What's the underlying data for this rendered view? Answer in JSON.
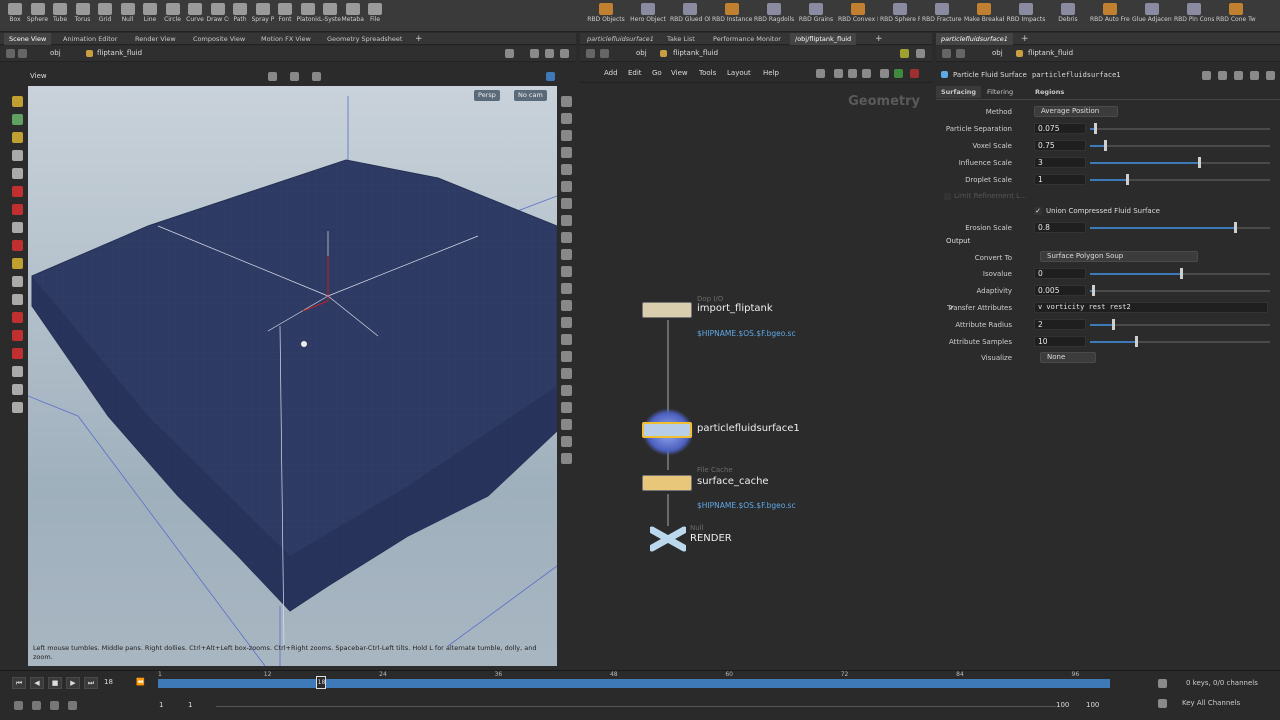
{
  "shelf": {
    "left_tools": [
      "Box",
      "Sphere",
      "Tube",
      "Torus",
      "Grid",
      "Null",
      "Line",
      "Circle",
      "Curve",
      "Draw Curve",
      "Path",
      "Spray Paint",
      "Font",
      "Platonic Solids",
      "L-System",
      "Metaball",
      "File"
    ],
    "right_tools": [
      "RBD Objects",
      "Hero Object",
      "RBD Glued Objects",
      "RBD Instanced Objects",
      "RBD Ragdolls",
      "RBD Grains",
      "RBD Convex Proxy",
      "RBD Sphere Proxy",
      "RBD Fractured Object",
      "Make Breakable",
      "RBD Impacts",
      "Debris",
      "RBD Auto Freeze",
      "Glue Adjacent",
      "RBD Pin Constraint",
      "RBD Cone Twist Const..."
    ]
  },
  "left_pane": {
    "tabs": [
      "Scene View",
      "Animation Editor",
      "Render View",
      "Composite View",
      "Motion FX View",
      "Geometry Spreadsheet"
    ],
    "path_root": "obj",
    "path_node": "fliptank_fluid",
    "view_label": "View",
    "persp_label": "Persp",
    "cam_label": "No cam",
    "help_text": "Left mouse tumbles. Middle pans. Right dollies. Ctrl+Alt+Left box-zooms. Ctrl+Right zooms. Spacebar-Ctrl-Left tilts. Hold L for alternate tumble, dolly, and zoom."
  },
  "mid_pane": {
    "tabs": [
      "particlefluidsurface1",
      "Take List",
      "Performance Monitor",
      "/obj/fliptank_fluid"
    ],
    "path_root": "obj",
    "path_node": "fliptank_fluid",
    "menu": [
      "Add",
      "Edit",
      "Go",
      "View",
      "Tools",
      "Layout",
      "Help"
    ],
    "context_label": "Geometry",
    "nodes": [
      {
        "type": "Dop I/O",
        "name": "import_fliptank",
        "sub": "$HIPNAME.$OS.$F.bgeo.sc",
        "color": "#d9cfae"
      },
      {
        "type": "",
        "name": "particlefluidsurface1",
        "sub": "",
        "color": "#d9cfae"
      },
      {
        "type": "File Cache",
        "name": "surface_cache",
        "sub": "$HIPNAME.$OS.$F.bgeo.sc",
        "color": "#e8c77a"
      },
      {
        "type": "Null",
        "name": "RENDER",
        "sub": "",
        "color": "#bcd8ec"
      }
    ]
  },
  "right_pane": {
    "tab": "particlefluidsurface1",
    "path_root": "obj",
    "path_node": "fliptank_fluid",
    "node_type": "Particle Fluid Surface",
    "node_name": "particlefluidsurface1",
    "param_tabs": [
      "Surfacing",
      "Filtering",
      "Regions"
    ],
    "method_label": "Method",
    "method_value": "Average Position",
    "params": [
      {
        "label": "Particle Separation",
        "value": "0.075",
        "fraction": 0.02
      },
      {
        "label": "Voxel Scale",
        "value": "0.75",
        "fraction": 0.08
      },
      {
        "label": "Influence Scale",
        "value": "3",
        "fraction": 0.6
      },
      {
        "label": "Droplet Scale",
        "value": "1",
        "fraction": 0.2
      }
    ],
    "limit_label": "Limit Refinement L...",
    "union_label": "Union Compressed Fluid Surface",
    "erosion": {
      "label": "Erosion Scale",
      "value": "0.8",
      "fraction": 0.8
    },
    "output_label": "Output",
    "convert_label": "Convert To",
    "convert_value": "Surface Polygon Soup",
    "params2": [
      {
        "label": "Isovalue",
        "value": "0",
        "fraction": 0.5
      },
      {
        "label": "Adaptivity",
        "value": "0.005",
        "fraction": 0.01
      }
    ],
    "transfer_label": "Transfer Attributes",
    "transfer_value": "v vorticity rest rest2",
    "params3": [
      {
        "label": "Attribute Radius",
        "value": "2",
        "fraction": 0.12
      },
      {
        "label": "Attribute Samples",
        "value": "10",
        "fraction": 0.25
      }
    ],
    "visualize_label": "Visualize",
    "visualize_value": "None"
  },
  "timeline": {
    "frame": "18",
    "ticks": [
      "1",
      "12",
      "24",
      "36",
      "48",
      "60",
      "72",
      "84",
      "96"
    ],
    "current_marker": "18",
    "start": "1",
    "start2": "1",
    "end": "100",
    "end2": "100",
    "keys_label": "0 keys, 0/0 channels",
    "channels_label": "Key All Channels"
  }
}
